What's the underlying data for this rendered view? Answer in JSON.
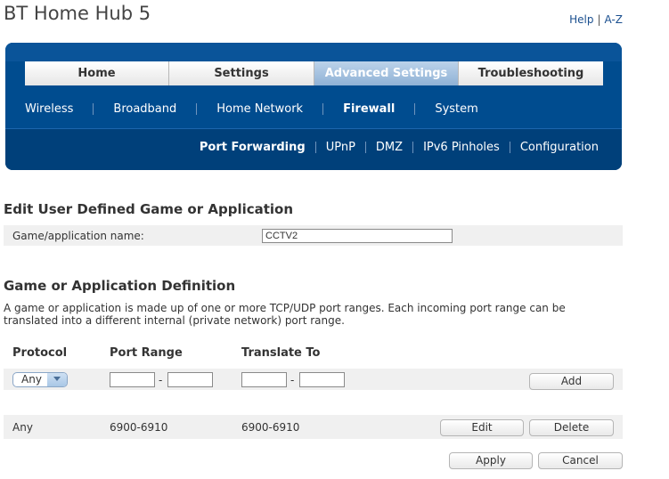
{
  "header": {
    "title": "BT Home Hub 5",
    "help_label": "Help",
    "separator": "|",
    "az_label": "A-Z"
  },
  "tabs": [
    {
      "label": "Home"
    },
    {
      "label": "Settings"
    },
    {
      "label": "Advanced Settings"
    },
    {
      "label": "Troubleshooting"
    }
  ],
  "sub_nav": [
    {
      "label": "Wireless"
    },
    {
      "label": "Broadband"
    },
    {
      "label": "Home Network"
    },
    {
      "label": "Firewall"
    },
    {
      "label": "System"
    }
  ],
  "firewall_nav": [
    {
      "label": "Port Forwarding"
    },
    {
      "label": "UPnP"
    },
    {
      "label": "DMZ"
    },
    {
      "label": "IPv6 Pinholes"
    },
    {
      "label": "Configuration"
    }
  ],
  "edit_section": {
    "title": "Edit User Defined Game or Application",
    "name_label": "Game/application name:",
    "name_value": "CCTV2"
  },
  "definition_section": {
    "title": "Game or Application Definition",
    "description": "A game or application is made up of one or more TCP/UDP port ranges. Each incoming port range can be translated into a different internal (private network) port range."
  },
  "table": {
    "headers": {
      "protocol": "Protocol",
      "port_range": "Port Range",
      "translate_to": "Translate To"
    },
    "entry": {
      "protocol_value": "Any",
      "dash": "-",
      "add_label": "Add"
    },
    "rows": [
      {
        "protocol": "Any",
        "port_range": "6900-6910",
        "translate_to": "6900-6910",
        "edit_label": "Edit",
        "delete_label": "Delete"
      }
    ]
  },
  "footer": {
    "apply_label": "Apply",
    "cancel_label": "Cancel"
  },
  "colors": {
    "nav_blue": "#004c8f",
    "active_tab": "#8fb1d5",
    "link_blue": "#1a4f8f"
  }
}
